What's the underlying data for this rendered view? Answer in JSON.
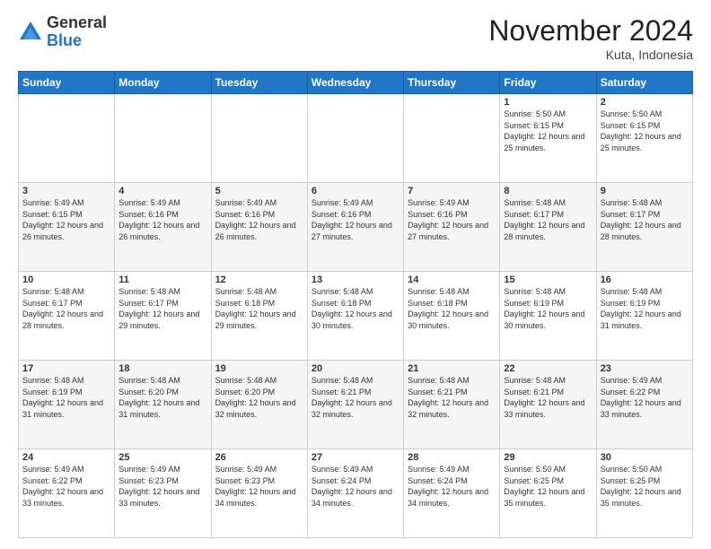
{
  "logo": {
    "general": "General",
    "blue": "Blue"
  },
  "header": {
    "month": "November 2024",
    "location": "Kuta, Indonesia"
  },
  "weekdays": [
    "Sunday",
    "Monday",
    "Tuesday",
    "Wednesday",
    "Thursday",
    "Friday",
    "Saturday"
  ],
  "weeks": [
    [
      {
        "day": "",
        "info": ""
      },
      {
        "day": "",
        "info": ""
      },
      {
        "day": "",
        "info": ""
      },
      {
        "day": "",
        "info": ""
      },
      {
        "day": "",
        "info": ""
      },
      {
        "day": "1",
        "info": "Sunrise: 5:50 AM\nSunset: 6:15 PM\nDaylight: 12 hours and 25 minutes."
      },
      {
        "day": "2",
        "info": "Sunrise: 5:50 AM\nSunset: 6:15 PM\nDaylight: 12 hours and 25 minutes."
      }
    ],
    [
      {
        "day": "3",
        "info": "Sunrise: 5:49 AM\nSunset: 6:15 PM\nDaylight: 12 hours and 26 minutes."
      },
      {
        "day": "4",
        "info": "Sunrise: 5:49 AM\nSunset: 6:16 PM\nDaylight: 12 hours and 26 minutes."
      },
      {
        "day": "5",
        "info": "Sunrise: 5:49 AM\nSunset: 6:16 PM\nDaylight: 12 hours and 26 minutes."
      },
      {
        "day": "6",
        "info": "Sunrise: 5:49 AM\nSunset: 6:16 PM\nDaylight: 12 hours and 27 minutes."
      },
      {
        "day": "7",
        "info": "Sunrise: 5:49 AM\nSunset: 6:16 PM\nDaylight: 12 hours and 27 minutes."
      },
      {
        "day": "8",
        "info": "Sunrise: 5:48 AM\nSunset: 6:17 PM\nDaylight: 12 hours and 28 minutes."
      },
      {
        "day": "9",
        "info": "Sunrise: 5:48 AM\nSunset: 6:17 PM\nDaylight: 12 hours and 28 minutes."
      }
    ],
    [
      {
        "day": "10",
        "info": "Sunrise: 5:48 AM\nSunset: 6:17 PM\nDaylight: 12 hours and 28 minutes."
      },
      {
        "day": "11",
        "info": "Sunrise: 5:48 AM\nSunset: 6:17 PM\nDaylight: 12 hours and 29 minutes."
      },
      {
        "day": "12",
        "info": "Sunrise: 5:48 AM\nSunset: 6:18 PM\nDaylight: 12 hours and 29 minutes."
      },
      {
        "day": "13",
        "info": "Sunrise: 5:48 AM\nSunset: 6:18 PM\nDaylight: 12 hours and 30 minutes."
      },
      {
        "day": "14",
        "info": "Sunrise: 5:48 AM\nSunset: 6:18 PM\nDaylight: 12 hours and 30 minutes."
      },
      {
        "day": "15",
        "info": "Sunrise: 5:48 AM\nSunset: 6:19 PM\nDaylight: 12 hours and 30 minutes."
      },
      {
        "day": "16",
        "info": "Sunrise: 5:48 AM\nSunset: 6:19 PM\nDaylight: 12 hours and 31 minutes."
      }
    ],
    [
      {
        "day": "17",
        "info": "Sunrise: 5:48 AM\nSunset: 6:19 PM\nDaylight: 12 hours and 31 minutes."
      },
      {
        "day": "18",
        "info": "Sunrise: 5:48 AM\nSunset: 6:20 PM\nDaylight: 12 hours and 31 minutes."
      },
      {
        "day": "19",
        "info": "Sunrise: 5:48 AM\nSunset: 6:20 PM\nDaylight: 12 hours and 32 minutes."
      },
      {
        "day": "20",
        "info": "Sunrise: 5:48 AM\nSunset: 6:21 PM\nDaylight: 12 hours and 32 minutes."
      },
      {
        "day": "21",
        "info": "Sunrise: 5:48 AM\nSunset: 6:21 PM\nDaylight: 12 hours and 32 minutes."
      },
      {
        "day": "22",
        "info": "Sunrise: 5:48 AM\nSunset: 6:21 PM\nDaylight: 12 hours and 33 minutes."
      },
      {
        "day": "23",
        "info": "Sunrise: 5:49 AM\nSunset: 6:22 PM\nDaylight: 12 hours and 33 minutes."
      }
    ],
    [
      {
        "day": "24",
        "info": "Sunrise: 5:49 AM\nSunset: 6:22 PM\nDaylight: 12 hours and 33 minutes."
      },
      {
        "day": "25",
        "info": "Sunrise: 5:49 AM\nSunset: 6:23 PM\nDaylight: 12 hours and 33 minutes."
      },
      {
        "day": "26",
        "info": "Sunrise: 5:49 AM\nSunset: 6:23 PM\nDaylight: 12 hours and 34 minutes."
      },
      {
        "day": "27",
        "info": "Sunrise: 5:49 AM\nSunset: 6:24 PM\nDaylight: 12 hours and 34 minutes."
      },
      {
        "day": "28",
        "info": "Sunrise: 5:49 AM\nSunset: 6:24 PM\nDaylight: 12 hours and 34 minutes."
      },
      {
        "day": "29",
        "info": "Sunrise: 5:50 AM\nSunset: 6:25 PM\nDaylight: 12 hours and 35 minutes."
      },
      {
        "day": "30",
        "info": "Sunrise: 5:50 AM\nSunset: 6:25 PM\nDaylight: 12 hours and 35 minutes."
      }
    ]
  ]
}
